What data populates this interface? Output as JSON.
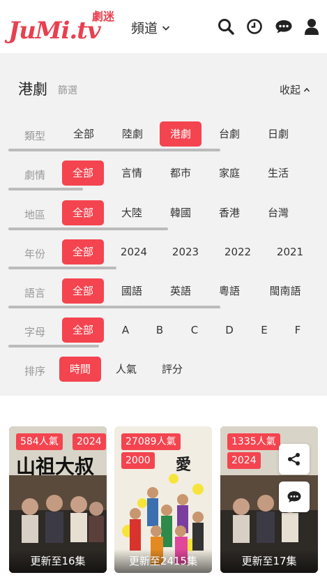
{
  "header": {
    "logo_text": "JuMi.tv",
    "logo_cn": "劇迷",
    "channel_label": "頻道"
  },
  "filter": {
    "title": "港劇",
    "subtitle": "篩選",
    "collapse_label": "收起",
    "rows": [
      {
        "label": "類型",
        "options": [
          "全部",
          "陸劇",
          "港劇",
          "台劇",
          "日劇"
        ],
        "active": 2
      },
      {
        "label": "劇情",
        "options": [
          "全部",
          "言情",
          "都市",
          "家庭",
          "生活"
        ],
        "active": 0
      },
      {
        "label": "地區",
        "options": [
          "全部",
          "大陸",
          "韓國",
          "香港",
          "台灣"
        ],
        "active": 0
      },
      {
        "label": "年份",
        "options": [
          "全部",
          "2024",
          "2023",
          "2022",
          "2021"
        ],
        "active": 0
      },
      {
        "label": "語言",
        "options": [
          "全部",
          "國語",
          "英語",
          "粵語",
          "閩南語"
        ],
        "active": 0
      },
      {
        "label": "字母",
        "options": [
          "全部",
          "A",
          "B",
          "C",
          "D",
          "E",
          "F"
        ],
        "active": 0
      },
      {
        "label": "排序",
        "options": [
          "時間",
          "人氣",
          "評分"
        ],
        "active": 0
      }
    ]
  },
  "cards": [
    {
      "popularity": "584人氣",
      "year": "2024",
      "update": "更新至16集",
      "poster_title": "山祖大叔"
    },
    {
      "popularity": "27089人氣",
      "year": "2000",
      "update": "更新至2415集",
      "poster_title": "愛‧回家"
    },
    {
      "popularity": "1335人氣",
      "year": "2024",
      "update": "更新至17集",
      "poster_title": ""
    }
  ],
  "colors": {
    "accent": "#f4444f",
    "logo": "#e8404f"
  }
}
